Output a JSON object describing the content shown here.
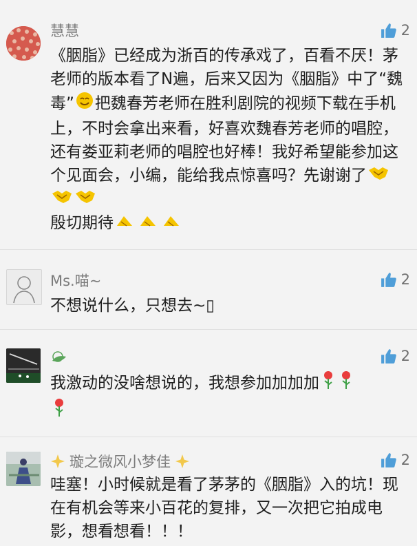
{
  "comments": [
    {
      "username": "慧慧",
      "likes": "2",
      "avatar_icon": "red-berries-avatar",
      "text_parts": [
        "《胭脂》已经成为浙百的传承戏了，百看不厌！茅老师的版本看了N遍，后来又因为《胭脂》中了“魏毒”",
        "把魏春芳老师在胜利剧院的视频下载在手机上，不时会拿出来看，好喜欢魏春芳老师的唱腔，还有娄亚莉老师的唱腔也好棒！我好希望能参加这个见面会，小编，能给我点惊喜吗？先谢谢了",
        "殷切期待"
      ],
      "emojis": [
        "smiling-face-emoji",
        "handshake-emoji",
        "clap-emoji"
      ]
    },
    {
      "username": "Ms.喵~",
      "likes": "2",
      "avatar_icon": "sketch-portrait-avatar",
      "text": "不想说什么，只想去~▯"
    },
    {
      "username": "",
      "likes": "2",
      "avatar_icon": "stadium-avatar",
      "username_icon": "sprout-icon",
      "text": "我激动的没啥想说的，我想参加加加加",
      "emojis": [
        "rose-emoji"
      ]
    },
    {
      "username": "璇之微风小梦佳",
      "likes": "2",
      "avatar_icon": "street-portrait-avatar",
      "username_icon": "sparkle-icon",
      "text": "哇塞！小时候就是看了茅茅的《胭脂》入的坑！现在有机会等来小百花的复排，又一次把它拍成电影，想看想看！！！"
    }
  ],
  "colors": {
    "like_icon": "#4f9ed8",
    "background": "#f3f3f3",
    "username": "#7c7c7c"
  }
}
